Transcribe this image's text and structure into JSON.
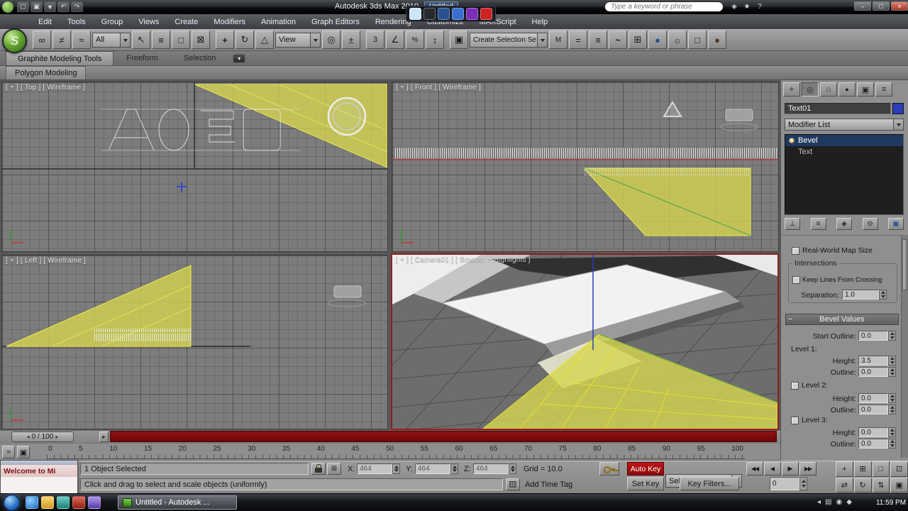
{
  "colors": {
    "autokey_red": "#9e0b0f",
    "active_viewport_border": "#8f1f1f",
    "object_yellow": "#d6d64f",
    "modifier_selected_blue": "#1e3a5f",
    "time_slider_red": "#7a0a0a"
  },
  "titlebar": {
    "app_title": "Autodesk 3ds Max 2010",
    "doc_title": "Untitled",
    "search_placeholder": "Type a keyword or phrase",
    "window_buttons": {
      "minimize": "–",
      "maximize": "□",
      "close": "×"
    }
  },
  "menubar": {
    "items": [
      "Edit",
      "Tools",
      "Group",
      "Views",
      "Create",
      "Modifiers",
      "Animation",
      "Graph Editors",
      "Rendering",
      "Customize",
      "MAXScript",
      "Help"
    ]
  },
  "toolbar": {
    "selection_filter_value": "All",
    "ref_coord_value": "View",
    "named_selection_placeholder": "Create Selection Se"
  },
  "ribbon": {
    "tabs": [
      "Graphite Modeling Tools",
      "Freeform",
      "Selection"
    ],
    "panel_label": "Polygon Modeling"
  },
  "viewports": {
    "top_label": "[ + ] [ Top ] [ Wireframe ]",
    "front_label": "[ + ] [ Front ] [ Wireframe ]",
    "left_label": "[ + ] [ Left ] [ Wireframe ]",
    "camera_label": "[ + ] [ Camera01 ] [ Smooth + Highlights ]"
  },
  "command_panel": {
    "object_name": "Text01",
    "modifier_list_label": "Modifier List",
    "stack": [
      "Bevel",
      "Text"
    ],
    "parameters": {
      "real_world_map_size": "Real-World Map Size",
      "intersections_title": "Intersections",
      "keep_lines": "Keep Lines From Crossing",
      "separation_label": "Separation:",
      "separation_value": "1.0",
      "bevel_values_title": "Bevel Values",
      "start_outline_label": "Start Outline:",
      "start_outline_value": "0.0",
      "level1_label": "Level 1:",
      "height_label": "Height:",
      "outline_label": "Outline:",
      "level1_height_value": "3.5",
      "level1_outline_value": "0.0",
      "level2_label": "Level 2:",
      "level2_height_value": "0.0",
      "level2_outline_value": "0.0",
      "level3_label": "Level 3:",
      "level3_height_value": "0.0",
      "level3_outline_value": "0.0"
    }
  },
  "timeline": {
    "slider_label": "0 / 100",
    "ticks": [
      "0",
      "5",
      "10",
      "15",
      "20",
      "25",
      "30",
      "35",
      "40",
      "45",
      "50",
      "55",
      "60",
      "65",
      "70",
      "75",
      "80",
      "85",
      "90",
      "95",
      "100"
    ]
  },
  "status_bar": {
    "selection_status": "1 Object Selected",
    "prompt": "Click and drag to select and scale objects (uniformly)",
    "x_label": "X:",
    "y_label": "Y:",
    "z_label": "Z:",
    "x_value": "464",
    "y_value": "464",
    "z_value": "464",
    "grid_status": "Grid = 10.0",
    "add_time_tag": "Add Time Tag",
    "auto_key_label": "Auto Key",
    "set_key_label": "Set Key",
    "key_mode_value": "Selected",
    "key_filters_label": "Key Filters...",
    "frame_value": "0"
  },
  "welcome_window": {
    "title": "Welcome to Mi"
  },
  "taskbar": {
    "window_button_label": "Untitled - Autodesk ...",
    "clock": "11:59 PM"
  }
}
